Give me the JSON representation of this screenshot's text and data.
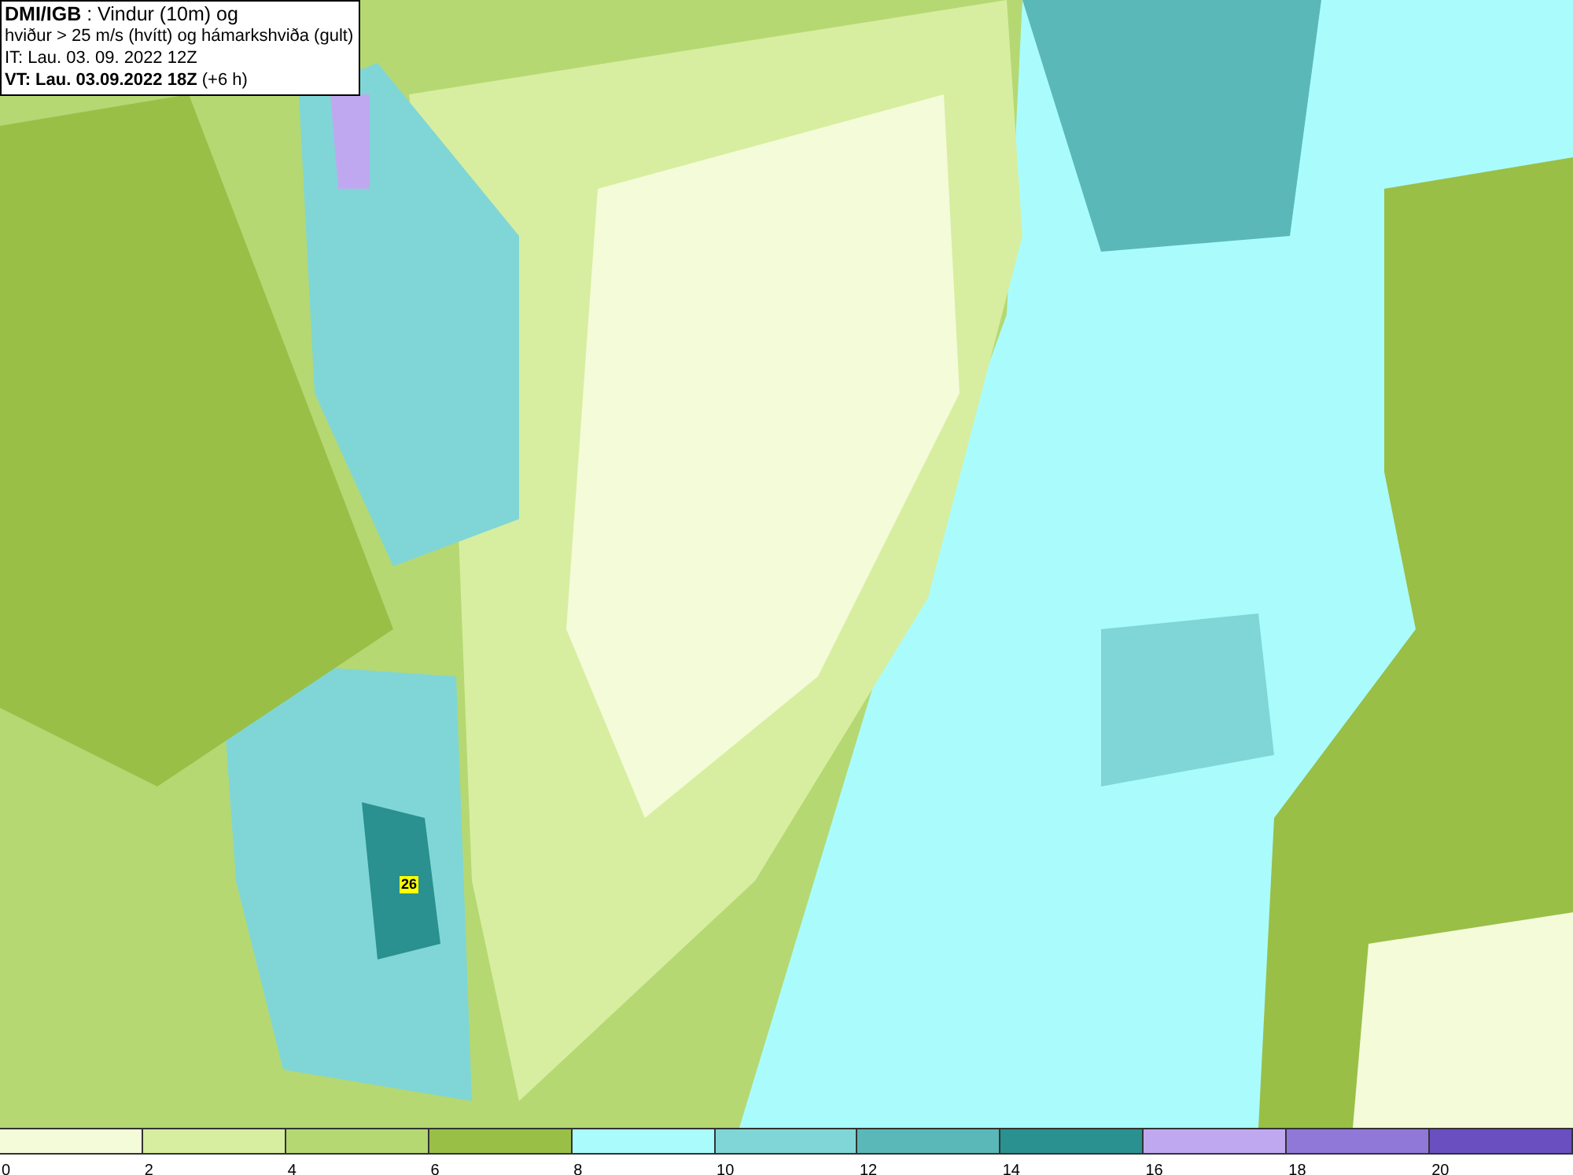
{
  "title_box": {
    "lines": [
      "**DMI/IGB** : Vindur (10m) og",
      "hviður > 25 m/s (hvítt) og hámarkshviða (gult)",
      "IT: Lau. 03. 09. 2022 12Z",
      "**VT: Lau. 03.09.2022 18Z** (+6 h)"
    ]
  },
  "map": {
    "gust_badge": "26"
  },
  "legend": {
    "bins": [
      {
        "label": "0",
        "color": "#f4fbd8"
      },
      {
        "label": "2",
        "color": "#d7eea0"
      },
      {
        "label": "4",
        "color": "#b5d873"
      },
      {
        "label": "6",
        "color": "#99bf47"
      },
      {
        "label": "8",
        "color": "#aafcfc"
      },
      {
        "label": "10",
        "color": "#80d6d6"
      },
      {
        "label": "12",
        "color": "#5ab8b8"
      },
      {
        "label": "14",
        "color": "#2a9090"
      },
      {
        "label": "16",
        "color": "#c0a8f0"
      },
      {
        "label": "18",
        "color": "#9078d8"
      },
      {
        "label": "20",
        "color": "#6a4fc0"
      }
    ]
  }
}
